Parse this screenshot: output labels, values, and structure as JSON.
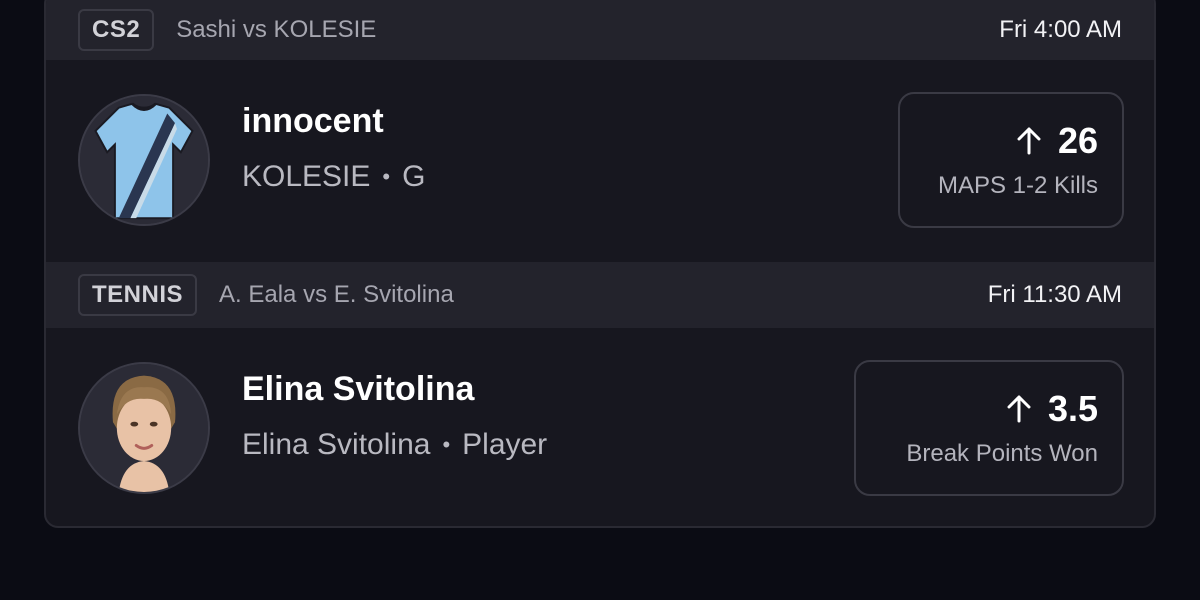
{
  "matches": [
    {
      "sport": "CS2",
      "title": "Sashi vs KOLESIE",
      "time": "Fri 4:00 AM",
      "player": {
        "name": "innocent",
        "team": "KOLESIE",
        "position": "G",
        "avatar_icon": "jersey-icon",
        "projection": {
          "direction": "up",
          "value": "26",
          "stat": "MAPS 1-2 Kills"
        }
      }
    },
    {
      "sport": "TENNIS",
      "title": "A. Eala vs E. Svitolina",
      "time": "Fri 11:30 AM",
      "player": {
        "name": "Elina Svitolina",
        "team": "Elina Svitolina",
        "position": "Player",
        "avatar_icon": "player-photo",
        "projection": {
          "direction": "up",
          "value": "3.5",
          "stat": "Break Points Won"
        }
      }
    }
  ],
  "separator": "•",
  "colors": {
    "background": "#0b0c14",
    "card": "#17171f",
    "header": "#23232c",
    "jersey": "#8ec4ea"
  }
}
